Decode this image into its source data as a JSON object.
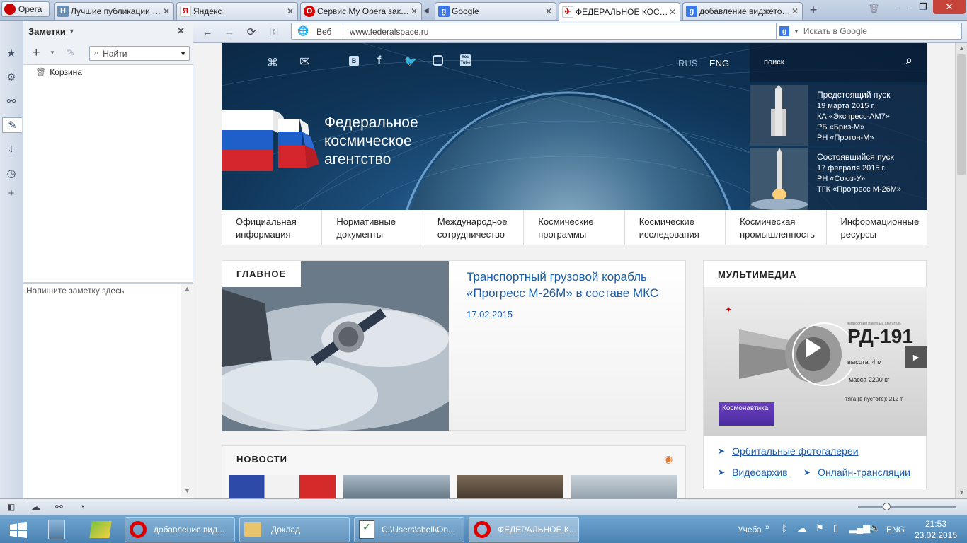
{
  "browser": {
    "menu_label": "Opera",
    "tabs": [
      {
        "label": "Лучшие публикации з...",
        "icon": "habr-icon",
        "active": false
      },
      {
        "label": "Яндекс",
        "icon": "yandex-icon",
        "active": false
      },
      {
        "label": "Сервис My Opera закр...",
        "icon": "opera-icon",
        "active": false
      },
      {
        "label": "Google",
        "icon": "google-icon",
        "active": false
      },
      {
        "label": "ФЕДЕРАЛЬНОЕ КОСМ...",
        "icon": "roscosmos-icon",
        "active": true
      },
      {
        "label": "добавление виджетов ...",
        "icon": "google-icon",
        "active": false
      }
    ],
    "address": {
      "security_label": "Веб",
      "url": "www.federalspace.ru"
    },
    "search": {
      "engine": "Google",
      "placeholder": "Искать в Google"
    }
  },
  "notes_panel": {
    "title": "Заметки",
    "search_placeholder": "Найти",
    "tree": [
      {
        "label": "Корзина",
        "icon": "trash-icon"
      }
    ],
    "editor_placeholder": "Напишите заметку здесь"
  },
  "page": {
    "lang": [
      "RUS",
      "ENG"
    ],
    "search_label": "поиск",
    "agency_name": [
      "Федеральное",
      "космическое",
      "агентство"
    ],
    "launches": [
      {
        "heading": "Предстоящий пуск",
        "lines": [
          "19 марта 2015 г.",
          "КА «Экспресс-АМ7»",
          "РБ «Бриз-М»",
          "РН «Протон-М»"
        ]
      },
      {
        "heading": "Состоявшийся пуск",
        "lines": [
          "17 февраля 2015 г.",
          "РН «Союз-У»",
          "ТГК «Прогресс М-26М»"
        ]
      }
    ],
    "menu": [
      [
        "Официальная",
        "информация"
      ],
      [
        "Нормативные",
        "документы"
      ],
      [
        "Международное",
        "сотрудничество"
      ],
      [
        "Космические",
        "программы"
      ],
      [
        "Космические",
        "исследования"
      ],
      [
        "Космическая",
        "промышленность"
      ],
      [
        "Информационные",
        "ресурсы"
      ]
    ],
    "main_section": {
      "label": "ГЛАВНОЕ",
      "headline": [
        "Транспортный грузовой корабль",
        "«Прогресс М-26М» в составе МКС"
      ],
      "date": "17.02.2015"
    },
    "multimedia": {
      "label": "МУЛЬТИМЕДИА",
      "video": {
        "title": "РД-191",
        "small_caption": "жидкостный ракетный двигатель",
        "specs": [
          "высота: 4 м",
          "масса 2200 кг",
          "тяга (в пустоте): 212 т"
        ],
        "tag": "Космонавтика"
      },
      "links": [
        "Орбитальные фотогалереи",
        "Видеоархив",
        "Онлайн-трансляции"
      ]
    },
    "news_label": "НОВОСТИ"
  },
  "taskbar": {
    "tasks": [
      {
        "label": "добавление вид...",
        "icon": "opera-icon",
        "active": false
      },
      {
        "label": "Доклад",
        "icon": "folder-icon",
        "active": false
      },
      {
        "label": "C:\\Users\\shell\\On...",
        "icon": "notepad-icon",
        "active": false
      },
      {
        "label": "ФЕДЕРАЛЬНОЕ К...",
        "icon": "opera-icon",
        "active": true
      }
    ],
    "tray_label": "Учеба",
    "language": "ENG",
    "time": "21:53",
    "date": "23.02.2015"
  }
}
